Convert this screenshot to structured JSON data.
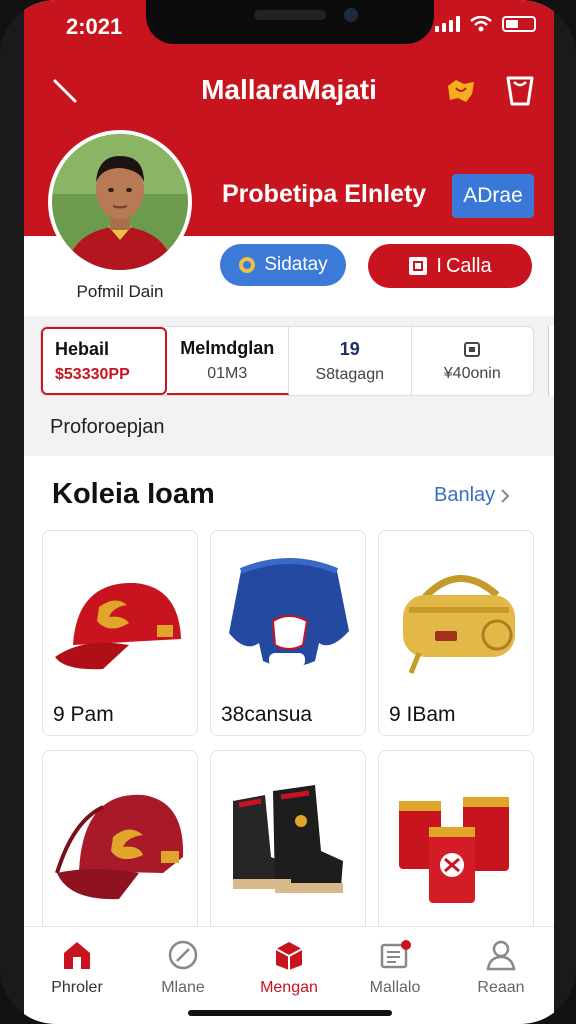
{
  "status": {
    "time": "2:021"
  },
  "header": {
    "title": "MallaraMajati"
  },
  "profile": {
    "name": "Pofmil Dain",
    "title": "Probetipa Elnlety",
    "action_label": "ADrae",
    "pill_blue_label": "Sidatay",
    "pill_red_label": "Calla",
    "pill_red_prefix": "I"
  },
  "stats": [
    {
      "line1": "Hebail",
      "line2": "$53330PP"
    },
    {
      "line1": "Melmdglan",
      "line2": "01M3"
    },
    {
      "line1": "19",
      "line2": "S8tagagn"
    },
    {
      "line1": "",
      "line2": "¥40onin"
    }
  ],
  "section_label": "Proforoepjan",
  "gallery": {
    "title": "Koleia Ioam",
    "see_all": "Banlay",
    "items": [
      {
        "label": "9 Pam",
        "icon": "red-cap"
      },
      {
        "label": "38cansua",
        "icon": "blue-jersey"
      },
      {
        "label": "9 IBam",
        "icon": "yellow-bag"
      },
      {
        "label": "",
        "icon": "red-cap-2"
      },
      {
        "label": "",
        "icon": "boots"
      },
      {
        "label": "",
        "icon": "red-mugs"
      }
    ]
  },
  "tabs": [
    {
      "label": "Phroler",
      "icon": "home-icon",
      "active": true
    },
    {
      "label": "Mlane",
      "icon": "compass-icon",
      "active": false
    },
    {
      "label": "Mengan",
      "icon": "box-icon",
      "active": true
    },
    {
      "label": "Mallalo",
      "icon": "news-icon",
      "active": false
    },
    {
      "label": "Reaan",
      "icon": "user-icon",
      "active": false
    }
  ],
  "colors": {
    "brand_red": "#c8141e",
    "accent_blue": "#3b7ad8"
  }
}
